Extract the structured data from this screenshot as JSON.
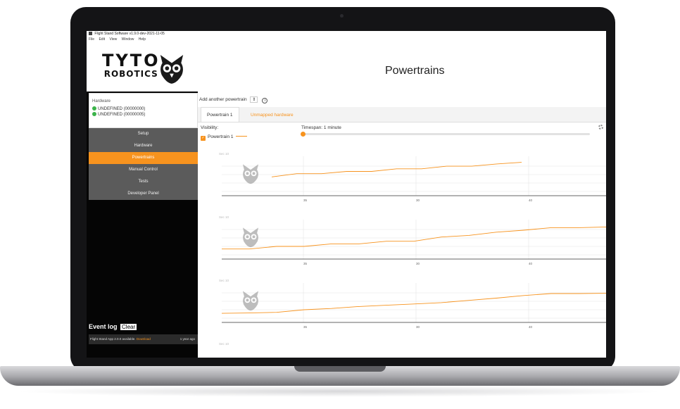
{
  "window": {
    "title": "Flight Stand Software v1.9.0-dev-2021-11-05",
    "menu": [
      "File",
      "Edit",
      "View",
      "Window",
      "Help"
    ]
  },
  "logo": {
    "line1": "TYTO",
    "line2": "ROBOTICS"
  },
  "hardware": {
    "title": "Hardware",
    "items": [
      "UNDEFINED (00000000)",
      "UNDEFINED (00000005)"
    ]
  },
  "nav": [
    "Setup",
    "Hardware",
    "Powertrains",
    "Manual Control",
    "Tests",
    "Developer Panel"
  ],
  "nav_active": "Powertrains",
  "event_log": {
    "title": "Event log",
    "clear_label": "Clear",
    "entry_text": "Flight Stand App 2.0.0 available.",
    "entry_link": "Download",
    "entry_time": "1 year ago"
  },
  "status_bar": [
    "0",
    "0",
    "0"
  ],
  "main": {
    "title": "Powertrains",
    "add_label": "Add another powertrain",
    "tabs": [
      "Powertrain 1",
      "Unmapped hardware"
    ],
    "visibility_label": "Visibility:",
    "visibility_item": "Powertrain 1",
    "timespan_label": "Timespan: 1 minute",
    "timespan_fraction": 0.0
  },
  "colors": {
    "accent": "#f7931e",
    "sidebar_bg": "#050505",
    "nav_bg": "#5b5b5b",
    "ok": "#3bb34a"
  },
  "icons": [
    "owl-logo-icon",
    "check-circle-icon",
    "info-icon",
    "gear-icon",
    "checkbox-icon"
  ],
  "chart_data": [
    {
      "type": "line",
      "ylabel": "Sec 10",
      "x_ticks": [
        "35",
        "30",
        "40"
      ],
      "series": [
        {
          "values": [
            0.45,
            0.55,
            0.55,
            0.62,
            0.62,
            0.7,
            0.7,
            0.78,
            0.78,
            0.85,
            0.9
          ]
        }
      ]
    },
    {
      "type": "line",
      "ylabel": "Sec 10",
      "x_ticks": [
        "35",
        "30",
        "40"
      ],
      "series": [
        {
          "values": [
            0.18,
            0.18,
            0.26,
            0.26,
            0.34,
            0.34,
            0.42,
            0.42,
            0.55,
            0.6,
            0.7,
            0.76,
            0.84,
            0.84,
            0.86
          ]
        }
      ]
    },
    {
      "type": "line",
      "ylabel": "Sec 10",
      "x_ticks": [
        "35",
        "30",
        "40"
      ],
      "series": [
        {
          "values": [
            0.15,
            0.16,
            0.18,
            0.26,
            0.3,
            0.36,
            0.4,
            0.44,
            0.48,
            0.55,
            0.62,
            0.7,
            0.76,
            0.76,
            0.77
          ]
        }
      ]
    },
    {
      "type": "line",
      "ylabel": "Sec 10",
      "x_ticks": [],
      "series": []
    }
  ]
}
